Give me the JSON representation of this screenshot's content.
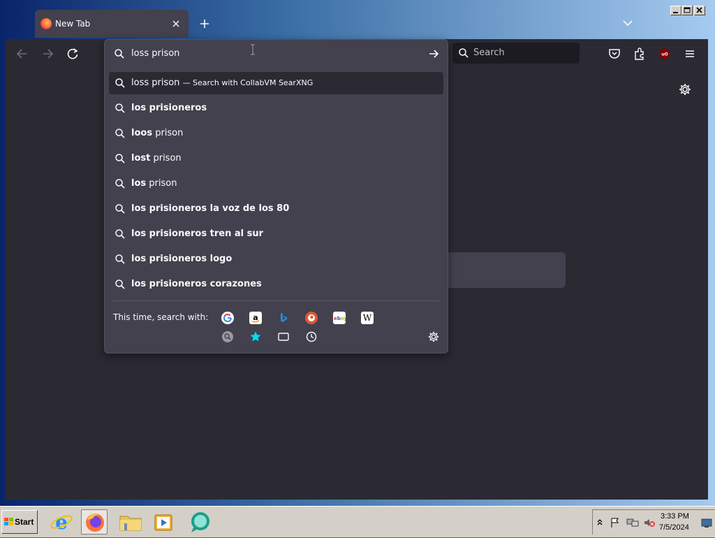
{
  "window": {
    "tab_title": "New Tab"
  },
  "toolbar": {
    "search_placeholder": "Search"
  },
  "urlbar": {
    "value": "loss prison",
    "suggestions": [
      {
        "bold": "",
        "rest": "loss prison",
        "hint": "— Search with CollabVM SearXNG",
        "selected": true
      },
      {
        "bold": "los prisioneros",
        "rest": "",
        "hint": "",
        "selected": false
      },
      {
        "bold": "loos",
        "rest": " prison",
        "hint": "",
        "selected": false
      },
      {
        "bold": "lost",
        "rest": " prison",
        "hint": "",
        "selected": false
      },
      {
        "bold": "los",
        "rest": " prison",
        "hint": "",
        "selected": false
      },
      {
        "bold": "los prisioneros la voz de los 80",
        "rest": "",
        "hint": "",
        "selected": false
      },
      {
        "bold": "los prisioneros tren al sur",
        "rest": "",
        "hint": "",
        "selected": false
      },
      {
        "bold": "los prisioneros logo",
        "rest": "",
        "hint": "",
        "selected": false
      },
      {
        "bold": "los prisioneros corazones",
        "rest": "",
        "hint": "",
        "selected": false
      }
    ],
    "oneoff_label": "This time, search with:",
    "engines": [
      "google-icon",
      "amazon-icon",
      "bing-icon",
      "duckduckgo-icon",
      "ebay-icon",
      "wikipedia-icon"
    ],
    "modes": [
      "searxng-icon",
      "bookmarks-icon",
      "tabs-icon",
      "history-icon"
    ]
  },
  "taskbar": {
    "start_label": "Start",
    "clock_time": "3:33 PM",
    "clock_date": "7/5/2024"
  },
  "colors": {
    "toolbar_bg": "#2b2a33",
    "panel_bg": "#42414d",
    "text": "#fbfbfe",
    "accent_blue": "#00ddff"
  }
}
